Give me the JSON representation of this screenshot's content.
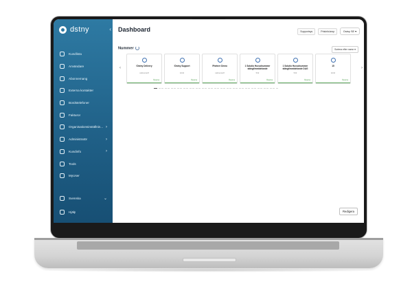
{
  "app": {
    "brand": "dstny"
  },
  "header": {
    "title": "Dashboard",
    "chips": [
      "Supportsys",
      "Prisinfo/arsp"
    ],
    "account": "Dstny SE"
  },
  "sidebar": {
    "items": [
      {
        "label": "Kundlista",
        "icon": "list-icon"
      },
      {
        "label": "Användare",
        "icon": "user-icon"
      },
      {
        "label": "Abonnemang",
        "icon": "phone-icon"
      },
      {
        "label": "Externa kontakter",
        "icon": "contacts-icon"
      },
      {
        "label": "Bordstelefoner",
        "icon": "desk-phone-icon"
      },
      {
        "label": "Fakturor",
        "icon": "invoice-icon"
      },
      {
        "label": "Organisationsinställnin...",
        "icon": "org-icon",
        "chevron": ">"
      },
      {
        "label": "Administratör",
        "icon": "admin-icon",
        "chevron": ">"
      },
      {
        "label": "Kundinfo",
        "icon": "gear-icon",
        "chevron": ">"
      },
      {
        "label": "Tools",
        "icon": "tools-icon"
      },
      {
        "label": "MyUser",
        "icon": "myuser-icon"
      }
    ],
    "bottom": [
      {
        "label": "Svenska",
        "icon": "flag-icon",
        "chevron": "v"
      },
      {
        "label": "Hjälp",
        "icon": "help-icon"
      }
    ]
  },
  "section": {
    "title": "Nummer",
    "sort_label": "Sortera efter namn"
  },
  "cards": [
    {
      "title": "!Dstny Delivery",
      "subtitle": "callcenter8",
      "link": "Öppna"
    },
    {
      "title": "!Dstny Support",
      "subtitle": "4244",
      "link": "Öppna"
    },
    {
      "title": "!Partner Demo",
      "subtitle": "callcenter8",
      "link": "Öppna"
    },
    {
      "title": "1 Solutio Huvudnummer stängt/meddelande",
      "subtitle": "532",
      "link": "Öppna"
    },
    {
      "title": "1 Solutio Huvudnummer stängt/meddelande DAG",
      "subtitle": "533",
      "link": "Öppna"
    },
    {
      "title": "15",
      "subtitle": "4244",
      "link": "Öppna"
    }
  ],
  "actions": {
    "edit_label": "Redigera"
  },
  "colors": {
    "sidebar_top": "#2e7aa3",
    "sidebar_bottom": "#174f74",
    "accent_green": "#5aa55a"
  }
}
